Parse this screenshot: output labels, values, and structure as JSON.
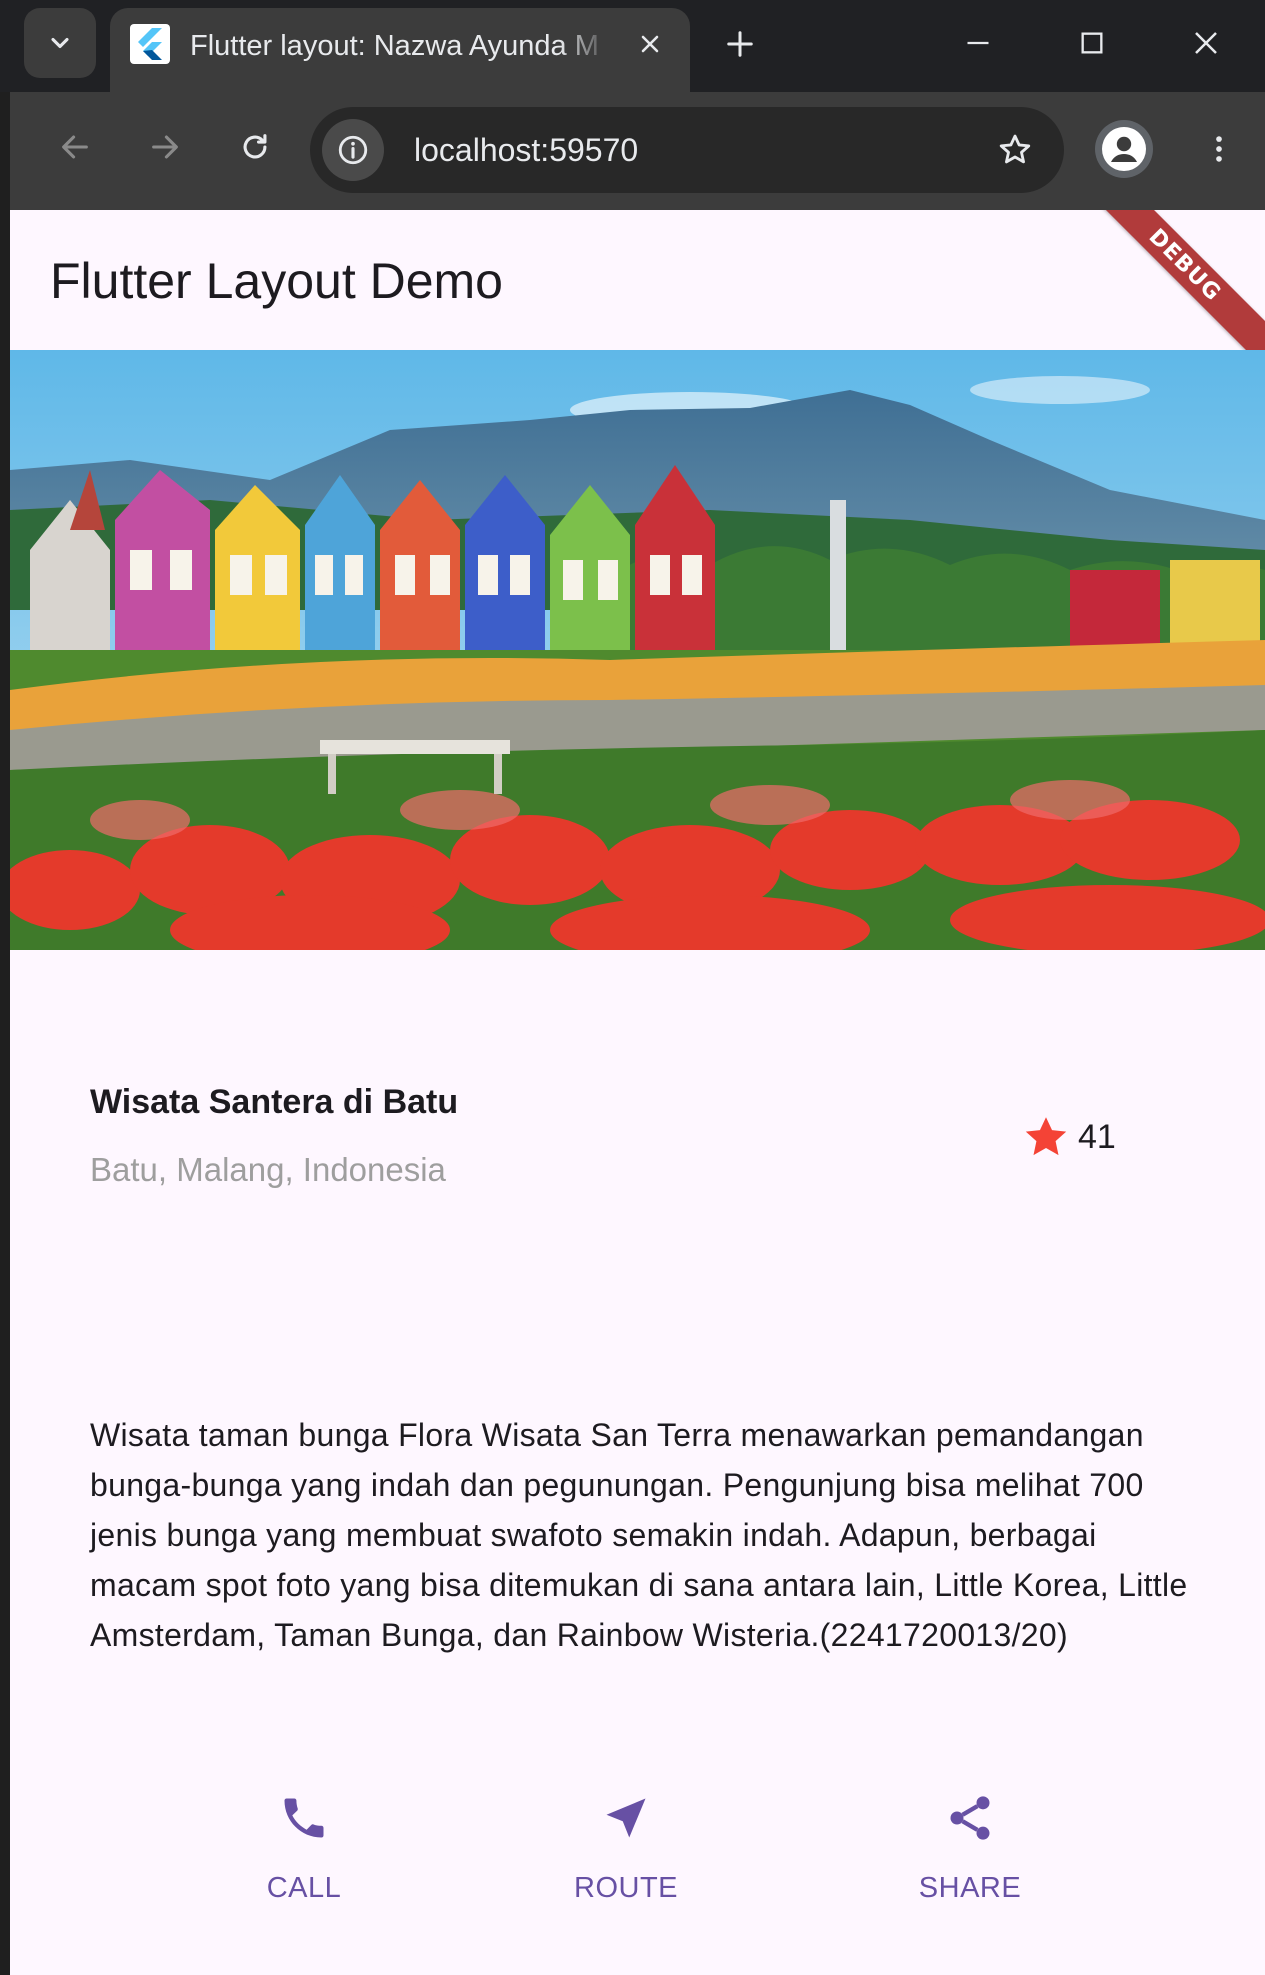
{
  "browser": {
    "tab_title": "Flutter layout: Nazwa Ayunda M",
    "url": "localhost:59570"
  },
  "app": {
    "title": "Flutter Layout Demo",
    "debug_banner": "DEBUG"
  },
  "place": {
    "name": "Wisata Santera di Batu",
    "location": "Batu, Malang, Indonesia",
    "favorite_count": "41"
  },
  "description": "Wisata taman bunga Flora Wisata San Terra menawarkan pemandangan bunga-bunga yang indah dan pegunungan. Pengunjung bisa melihat 700 jenis bunga yang membuat swafoto semakin indah. Adapun, berbagai macam spot foto yang bisa ditemukan di sana antara lain, Little Korea, Little Amsterdam, Taman Bunga, dan Rainbow Wisteria.(2241720013/20)",
  "actions": [
    {
      "label": "CALL",
      "icon": "phone-icon"
    },
    {
      "label": "ROUTE",
      "icon": "navigation-icon"
    },
    {
      "label": "SHARE",
      "icon": "share-icon"
    }
  ],
  "colors": {
    "primary": "#6750a4",
    "star": "#f44336",
    "page_background": "#fef7ff",
    "debug_banner": "#b13b3b",
    "secondary_text": "#9e9e9e"
  }
}
